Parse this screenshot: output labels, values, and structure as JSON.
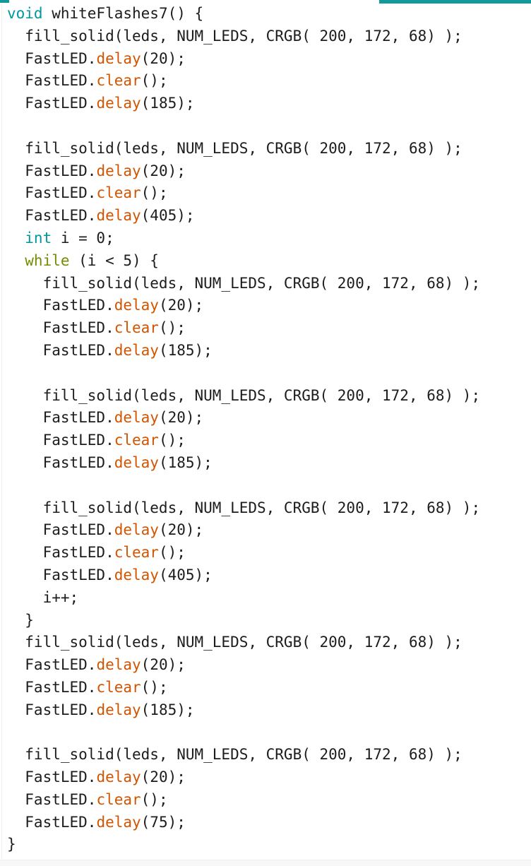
{
  "editor": {
    "app": "arduino-ide-code-editor",
    "language": "cpp",
    "function_name": "whiteFlashes7",
    "colors": {
      "background": "#ffffff",
      "plain_text": "#1c1c1c",
      "keyword_teal": "#00979c",
      "control_olive": "#728e00",
      "library_function_orange": "#d35400",
      "scrollbar_teal": "#129a9b",
      "bottom_strip": "#f7f7f8"
    },
    "scrollbar": {
      "name": "horizontal-scrollbar-thumb",
      "position": "top-right",
      "color": "#129a9b"
    },
    "lines": [
      {
        "indent": 0,
        "tokens": [
          {
            "t": "void",
            "c": "kw"
          },
          {
            "t": " whiteFlashes7() {",
            "c": "plain"
          }
        ]
      },
      {
        "indent": 1,
        "tokens": [
          {
            "t": "fill_solid(leds, NUM_LEDS, CRGB( 200, 172, 68) );",
            "c": "plain"
          }
        ]
      },
      {
        "indent": 1,
        "tokens": [
          {
            "t": "FastLED.",
            "c": "plain"
          },
          {
            "t": "delay",
            "c": "fn"
          },
          {
            "t": "(20);",
            "c": "plain"
          }
        ]
      },
      {
        "indent": 1,
        "tokens": [
          {
            "t": "FastLED.",
            "c": "plain"
          },
          {
            "t": "clear",
            "c": "fn"
          },
          {
            "t": "();",
            "c": "plain"
          }
        ]
      },
      {
        "indent": 1,
        "tokens": [
          {
            "t": "FastLED.",
            "c": "plain"
          },
          {
            "t": "delay",
            "c": "fn"
          },
          {
            "t": "(185);",
            "c": "plain"
          }
        ]
      },
      {
        "indent": 0,
        "tokens": []
      },
      {
        "indent": 1,
        "tokens": [
          {
            "t": "fill_solid(leds, NUM_LEDS, CRGB( 200, 172, 68) );",
            "c": "plain"
          }
        ]
      },
      {
        "indent": 1,
        "tokens": [
          {
            "t": "FastLED.",
            "c": "plain"
          },
          {
            "t": "delay",
            "c": "fn"
          },
          {
            "t": "(20);",
            "c": "plain"
          }
        ]
      },
      {
        "indent": 1,
        "tokens": [
          {
            "t": "FastLED.",
            "c": "plain"
          },
          {
            "t": "clear",
            "c": "fn"
          },
          {
            "t": "();",
            "c": "plain"
          }
        ]
      },
      {
        "indent": 1,
        "tokens": [
          {
            "t": "FastLED.",
            "c": "plain"
          },
          {
            "t": "delay",
            "c": "fn"
          },
          {
            "t": "(405);",
            "c": "plain"
          }
        ]
      },
      {
        "indent": 1,
        "tokens": [
          {
            "t": "int",
            "c": "kw"
          },
          {
            "t": " i = 0;",
            "c": "plain"
          }
        ]
      },
      {
        "indent": 1,
        "tokens": [
          {
            "t": "while",
            "c": "ctrl"
          },
          {
            "t": " (i < 5) {",
            "c": "plain"
          }
        ]
      },
      {
        "indent": 2,
        "tokens": [
          {
            "t": "fill_solid(leds, NUM_LEDS, CRGB( 200, 172, 68) );",
            "c": "plain"
          }
        ]
      },
      {
        "indent": 2,
        "tokens": [
          {
            "t": "FastLED.",
            "c": "plain"
          },
          {
            "t": "delay",
            "c": "fn"
          },
          {
            "t": "(20);",
            "c": "plain"
          }
        ]
      },
      {
        "indent": 2,
        "tokens": [
          {
            "t": "FastLED.",
            "c": "plain"
          },
          {
            "t": "clear",
            "c": "fn"
          },
          {
            "t": "();",
            "c": "plain"
          }
        ]
      },
      {
        "indent": 2,
        "tokens": [
          {
            "t": "FastLED.",
            "c": "plain"
          },
          {
            "t": "delay",
            "c": "fn"
          },
          {
            "t": "(185);",
            "c": "plain"
          }
        ]
      },
      {
        "indent": 0,
        "tokens": []
      },
      {
        "indent": 2,
        "tokens": [
          {
            "t": "fill_solid(leds, NUM_LEDS, CRGB( 200, 172, 68) );",
            "c": "plain"
          }
        ]
      },
      {
        "indent": 2,
        "tokens": [
          {
            "t": "FastLED.",
            "c": "plain"
          },
          {
            "t": "delay",
            "c": "fn"
          },
          {
            "t": "(20);",
            "c": "plain"
          }
        ]
      },
      {
        "indent": 2,
        "tokens": [
          {
            "t": "FastLED.",
            "c": "plain"
          },
          {
            "t": "clear",
            "c": "fn"
          },
          {
            "t": "();",
            "c": "plain"
          }
        ]
      },
      {
        "indent": 2,
        "tokens": [
          {
            "t": "FastLED.",
            "c": "plain"
          },
          {
            "t": "delay",
            "c": "fn"
          },
          {
            "t": "(185);",
            "c": "plain"
          }
        ]
      },
      {
        "indent": 0,
        "tokens": []
      },
      {
        "indent": 2,
        "tokens": [
          {
            "t": "fill_solid(leds, NUM_LEDS, CRGB( 200, 172, 68) );",
            "c": "plain"
          }
        ]
      },
      {
        "indent": 2,
        "tokens": [
          {
            "t": "FastLED.",
            "c": "plain"
          },
          {
            "t": "delay",
            "c": "fn"
          },
          {
            "t": "(20);",
            "c": "plain"
          }
        ]
      },
      {
        "indent": 2,
        "tokens": [
          {
            "t": "FastLED.",
            "c": "plain"
          },
          {
            "t": "clear",
            "c": "fn"
          },
          {
            "t": "();",
            "c": "plain"
          }
        ]
      },
      {
        "indent": 2,
        "tokens": [
          {
            "t": "FastLED.",
            "c": "plain"
          },
          {
            "t": "delay",
            "c": "fn"
          },
          {
            "t": "(405);",
            "c": "plain"
          }
        ]
      },
      {
        "indent": 2,
        "tokens": [
          {
            "t": "i++;",
            "c": "plain"
          }
        ]
      },
      {
        "indent": 1,
        "tokens": [
          {
            "t": "}",
            "c": "plain"
          }
        ]
      },
      {
        "indent": 1,
        "tokens": [
          {
            "t": "fill_solid(leds, NUM_LEDS, CRGB( 200, 172, 68) );",
            "c": "plain"
          }
        ]
      },
      {
        "indent": 1,
        "tokens": [
          {
            "t": "FastLED.",
            "c": "plain"
          },
          {
            "t": "delay",
            "c": "fn"
          },
          {
            "t": "(20);",
            "c": "plain"
          }
        ]
      },
      {
        "indent": 1,
        "tokens": [
          {
            "t": "FastLED.",
            "c": "plain"
          },
          {
            "t": "clear",
            "c": "fn"
          },
          {
            "t": "();",
            "c": "plain"
          }
        ]
      },
      {
        "indent": 1,
        "tokens": [
          {
            "t": "FastLED.",
            "c": "plain"
          },
          {
            "t": "delay",
            "c": "fn"
          },
          {
            "t": "(185);",
            "c": "plain"
          }
        ]
      },
      {
        "indent": 0,
        "tokens": []
      },
      {
        "indent": 1,
        "tokens": [
          {
            "t": "fill_solid(leds, NUM_LEDS, CRGB( 200, 172, 68) );",
            "c": "plain"
          }
        ]
      },
      {
        "indent": 1,
        "tokens": [
          {
            "t": "FastLED.",
            "c": "plain"
          },
          {
            "t": "delay",
            "c": "fn"
          },
          {
            "t": "(20);",
            "c": "plain"
          }
        ]
      },
      {
        "indent": 1,
        "tokens": [
          {
            "t": "FastLED.",
            "c": "plain"
          },
          {
            "t": "clear",
            "c": "fn"
          },
          {
            "t": "();",
            "c": "plain"
          }
        ]
      },
      {
        "indent": 1,
        "tokens": [
          {
            "t": "FastLED.",
            "c": "plain"
          },
          {
            "t": "delay",
            "c": "fn"
          },
          {
            "t": "(75);",
            "c": "plain"
          }
        ]
      },
      {
        "indent": 0,
        "tokens": [
          {
            "t": "}",
            "c": "plain"
          }
        ]
      }
    ]
  }
}
